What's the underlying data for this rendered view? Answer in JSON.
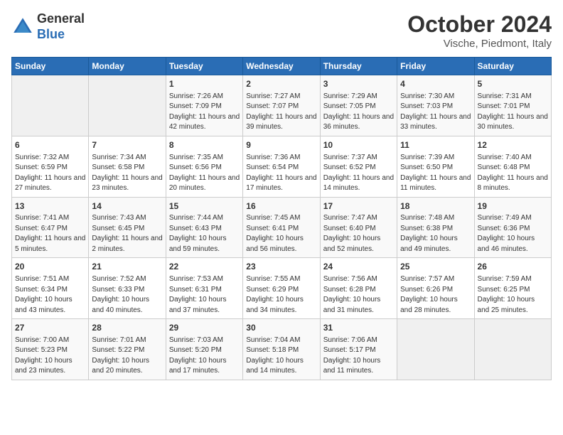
{
  "logo": {
    "general": "General",
    "blue": "Blue"
  },
  "title": "October 2024",
  "location": "Vische, Piedmont, Italy",
  "days_of_week": [
    "Sunday",
    "Monday",
    "Tuesday",
    "Wednesday",
    "Thursday",
    "Friday",
    "Saturday"
  ],
  "weeks": [
    [
      {
        "day": "",
        "info": ""
      },
      {
        "day": "",
        "info": ""
      },
      {
        "day": "1",
        "info": "Sunrise: 7:26 AM\nSunset: 7:09 PM\nDaylight: 11 hours and 42 minutes."
      },
      {
        "day": "2",
        "info": "Sunrise: 7:27 AM\nSunset: 7:07 PM\nDaylight: 11 hours and 39 minutes."
      },
      {
        "day": "3",
        "info": "Sunrise: 7:29 AM\nSunset: 7:05 PM\nDaylight: 11 hours and 36 minutes."
      },
      {
        "day": "4",
        "info": "Sunrise: 7:30 AM\nSunset: 7:03 PM\nDaylight: 11 hours and 33 minutes."
      },
      {
        "day": "5",
        "info": "Sunrise: 7:31 AM\nSunset: 7:01 PM\nDaylight: 11 hours and 30 minutes."
      }
    ],
    [
      {
        "day": "6",
        "info": "Sunrise: 7:32 AM\nSunset: 6:59 PM\nDaylight: 11 hours and 27 minutes."
      },
      {
        "day": "7",
        "info": "Sunrise: 7:34 AM\nSunset: 6:58 PM\nDaylight: 11 hours and 23 minutes."
      },
      {
        "day": "8",
        "info": "Sunrise: 7:35 AM\nSunset: 6:56 PM\nDaylight: 11 hours and 20 minutes."
      },
      {
        "day": "9",
        "info": "Sunrise: 7:36 AM\nSunset: 6:54 PM\nDaylight: 11 hours and 17 minutes."
      },
      {
        "day": "10",
        "info": "Sunrise: 7:37 AM\nSunset: 6:52 PM\nDaylight: 11 hours and 14 minutes."
      },
      {
        "day": "11",
        "info": "Sunrise: 7:39 AM\nSunset: 6:50 PM\nDaylight: 11 hours and 11 minutes."
      },
      {
        "day": "12",
        "info": "Sunrise: 7:40 AM\nSunset: 6:48 PM\nDaylight: 11 hours and 8 minutes."
      }
    ],
    [
      {
        "day": "13",
        "info": "Sunrise: 7:41 AM\nSunset: 6:47 PM\nDaylight: 11 hours and 5 minutes."
      },
      {
        "day": "14",
        "info": "Sunrise: 7:43 AM\nSunset: 6:45 PM\nDaylight: 11 hours and 2 minutes."
      },
      {
        "day": "15",
        "info": "Sunrise: 7:44 AM\nSunset: 6:43 PM\nDaylight: 10 hours and 59 minutes."
      },
      {
        "day": "16",
        "info": "Sunrise: 7:45 AM\nSunset: 6:41 PM\nDaylight: 10 hours and 56 minutes."
      },
      {
        "day": "17",
        "info": "Sunrise: 7:47 AM\nSunset: 6:40 PM\nDaylight: 10 hours and 52 minutes."
      },
      {
        "day": "18",
        "info": "Sunrise: 7:48 AM\nSunset: 6:38 PM\nDaylight: 10 hours and 49 minutes."
      },
      {
        "day": "19",
        "info": "Sunrise: 7:49 AM\nSunset: 6:36 PM\nDaylight: 10 hours and 46 minutes."
      }
    ],
    [
      {
        "day": "20",
        "info": "Sunrise: 7:51 AM\nSunset: 6:34 PM\nDaylight: 10 hours and 43 minutes."
      },
      {
        "day": "21",
        "info": "Sunrise: 7:52 AM\nSunset: 6:33 PM\nDaylight: 10 hours and 40 minutes."
      },
      {
        "day": "22",
        "info": "Sunrise: 7:53 AM\nSunset: 6:31 PM\nDaylight: 10 hours and 37 minutes."
      },
      {
        "day": "23",
        "info": "Sunrise: 7:55 AM\nSunset: 6:29 PM\nDaylight: 10 hours and 34 minutes."
      },
      {
        "day": "24",
        "info": "Sunrise: 7:56 AM\nSunset: 6:28 PM\nDaylight: 10 hours and 31 minutes."
      },
      {
        "day": "25",
        "info": "Sunrise: 7:57 AM\nSunset: 6:26 PM\nDaylight: 10 hours and 28 minutes."
      },
      {
        "day": "26",
        "info": "Sunrise: 7:59 AM\nSunset: 6:25 PM\nDaylight: 10 hours and 25 minutes."
      }
    ],
    [
      {
        "day": "27",
        "info": "Sunrise: 7:00 AM\nSunset: 5:23 PM\nDaylight: 10 hours and 23 minutes."
      },
      {
        "day": "28",
        "info": "Sunrise: 7:01 AM\nSunset: 5:22 PM\nDaylight: 10 hours and 20 minutes."
      },
      {
        "day": "29",
        "info": "Sunrise: 7:03 AM\nSunset: 5:20 PM\nDaylight: 10 hours and 17 minutes."
      },
      {
        "day": "30",
        "info": "Sunrise: 7:04 AM\nSunset: 5:18 PM\nDaylight: 10 hours and 14 minutes."
      },
      {
        "day": "31",
        "info": "Sunrise: 7:06 AM\nSunset: 5:17 PM\nDaylight: 10 hours and 11 minutes."
      },
      {
        "day": "",
        "info": ""
      },
      {
        "day": "",
        "info": ""
      }
    ]
  ]
}
